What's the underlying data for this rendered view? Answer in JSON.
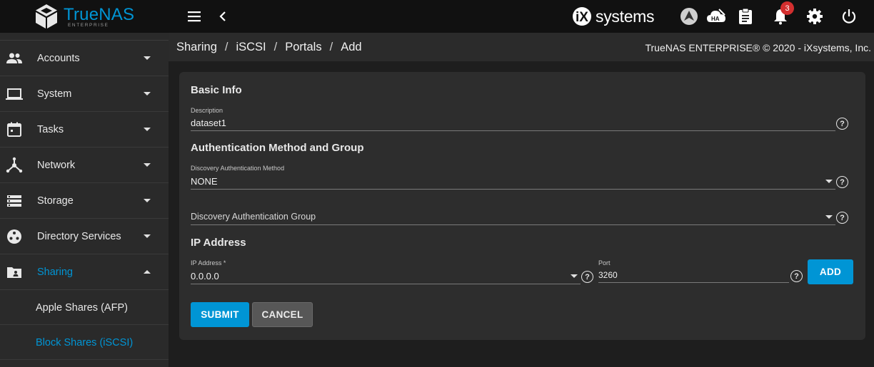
{
  "brand": {
    "name": "TrueNAS",
    "sub": "ENTERPRISE"
  },
  "topbar": {
    "vendor": "systems",
    "vendor_prefix": "iX",
    "notification_count": "3"
  },
  "sidebar": {
    "items": [
      {
        "label": "Accounts",
        "icon": "people-icon"
      },
      {
        "label": "System",
        "icon": "laptop-icon"
      },
      {
        "label": "Tasks",
        "icon": "calendar-icon"
      },
      {
        "label": "Network",
        "icon": "network-icon"
      },
      {
        "label": "Storage",
        "icon": "storage-icon"
      },
      {
        "label": "Directory Services",
        "icon": "directory-icon"
      },
      {
        "label": "Sharing",
        "icon": "folder-share-icon"
      }
    ],
    "sub_items": [
      {
        "label": "Apple Shares (AFP)"
      },
      {
        "label": "Block Shares (iSCSI)"
      }
    ]
  },
  "breadcrumb": {
    "items": [
      "Sharing",
      "iSCSI",
      "Portals",
      "Add"
    ],
    "sep": "/"
  },
  "copyright": "TrueNAS ENTERPRISE® © 2020 - iXsystems, Inc.",
  "form": {
    "basic_info_title": "Basic Info",
    "description_label": "Description",
    "description_value": "dataset1",
    "auth_title": "Authentication Method and Group",
    "discovery_method_label": "Discovery Authentication Method",
    "discovery_method_value": "NONE",
    "discovery_group_placeholder": "Discovery Authentication Group",
    "ip_title": "IP Address",
    "ip_label": "IP Address *",
    "ip_value": "0.0.0.0",
    "port_label": "Port",
    "port_value": "3260",
    "add_label": "ADD",
    "submit_label": "SUBMIT",
    "cancel_label": "CANCEL",
    "help_glyph": "?"
  },
  "colors": {
    "accent": "#0095d5",
    "topbar": "#111111",
    "sidebar": "#2a2a2a",
    "card": "#2d2d2d",
    "badge": "#d32f2f"
  }
}
